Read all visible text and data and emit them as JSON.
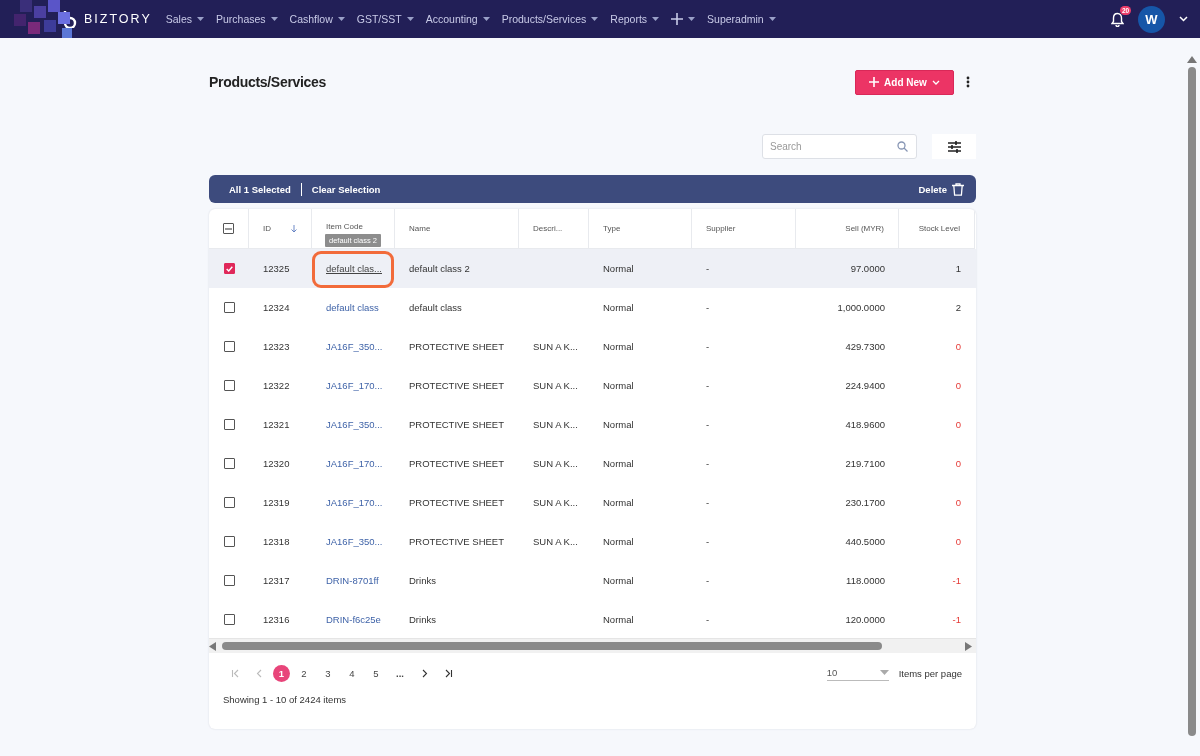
{
  "nav": {
    "brand": "BIZTORY",
    "items": [
      {
        "kind": "text",
        "label": "Sales"
      },
      {
        "kind": "text",
        "label": "Purchases"
      },
      {
        "kind": "text",
        "label": "Cashflow"
      },
      {
        "kind": "text",
        "label": "GST/SST"
      },
      {
        "kind": "text",
        "label": "Accounting"
      },
      {
        "kind": "text",
        "label": "Products/Services"
      },
      {
        "kind": "text",
        "label": "Reports"
      },
      {
        "kind": "add"
      },
      {
        "kind": "text",
        "label": "Superadmin"
      }
    ],
    "notifications": "20",
    "avatar": "W"
  },
  "page": {
    "title": "Products/Services",
    "add_button": "Add New"
  },
  "search": {
    "placeholder": "Search"
  },
  "selection_bar": {
    "summary": "All 1 Selected",
    "clear": "Clear Selection",
    "delete": "Delete"
  },
  "table": {
    "columns": [
      "ID",
      "Item Code",
      "Name",
      "Descri...",
      "Type",
      "Supplier",
      "Sell (MYR)",
      "Stock Level"
    ],
    "tooltip": "default class 2",
    "select_all": {
      "indeterminate": true
    },
    "rows": [
      {
        "selected": true,
        "id": "12325",
        "code": "default clas...",
        "name": "default class 2",
        "desc": "",
        "type": "Normal",
        "supplier": "-",
        "sell": "97.0000",
        "stock": "1",
        "alert": false
      },
      {
        "selected": false,
        "id": "12324",
        "code": "default class",
        "name": "default class",
        "desc": "",
        "type": "Normal",
        "supplier": "-",
        "sell": "1,000.0000",
        "stock": "2",
        "alert": false
      },
      {
        "selected": false,
        "id": "12323",
        "code": "JA16F_350...",
        "name": "PROTECTIVE SHEET",
        "desc": "SUN A K...",
        "type": "Normal",
        "supplier": "-",
        "sell": "429.7300",
        "stock": "0",
        "alert": true
      },
      {
        "selected": false,
        "id": "12322",
        "code": "JA16F_170...",
        "name": "PROTECTIVE SHEET",
        "desc": "SUN A K...",
        "type": "Normal",
        "supplier": "-",
        "sell": "224.9400",
        "stock": "0",
        "alert": true
      },
      {
        "selected": false,
        "id": "12321",
        "code": "JA16F_350...",
        "name": "PROTECTIVE SHEET",
        "desc": "SUN A K...",
        "type": "Normal",
        "supplier": "-",
        "sell": "418.9600",
        "stock": "0",
        "alert": true
      },
      {
        "selected": false,
        "id": "12320",
        "code": "JA16F_170...",
        "name": "PROTECTIVE SHEET",
        "desc": "SUN A K...",
        "type": "Normal",
        "supplier": "-",
        "sell": "219.7100",
        "stock": "0",
        "alert": true
      },
      {
        "selected": false,
        "id": "12319",
        "code": "JA16F_170...",
        "name": "PROTECTIVE SHEET",
        "desc": "SUN A K...",
        "type": "Normal",
        "supplier": "-",
        "sell": "230.1700",
        "stock": "0",
        "alert": true
      },
      {
        "selected": false,
        "id": "12318",
        "code": "JA16F_350...",
        "name": "PROTECTIVE SHEET",
        "desc": "SUN A K...",
        "type": "Normal",
        "supplier": "-",
        "sell": "440.5000",
        "stock": "0",
        "alert": true
      },
      {
        "selected": false,
        "id": "12317",
        "code": "DRIN-8701ff",
        "name": "Drinks",
        "desc": "",
        "type": "Normal",
        "supplier": "-",
        "sell": "118.0000",
        "stock": "-1",
        "alert": true
      },
      {
        "selected": false,
        "id": "12316",
        "code": "DRIN-f6c25e",
        "name": "Drinks",
        "desc": "",
        "type": "Normal",
        "supplier": "-",
        "sell": "120.0000",
        "stock": "-1",
        "alert": true
      }
    ]
  },
  "pager": {
    "pages": [
      {
        "label": "1",
        "selected": true
      },
      {
        "label": "2",
        "selected": false
      },
      {
        "label": "3",
        "selected": false
      },
      {
        "label": "4",
        "selected": false
      },
      {
        "label": "5",
        "selected": false
      },
      {
        "label": "...",
        "selected": false
      }
    ],
    "per_page": "10",
    "per_page_label": "Items per page",
    "showing": "Showing 1 - 10 of 2424 items"
  }
}
